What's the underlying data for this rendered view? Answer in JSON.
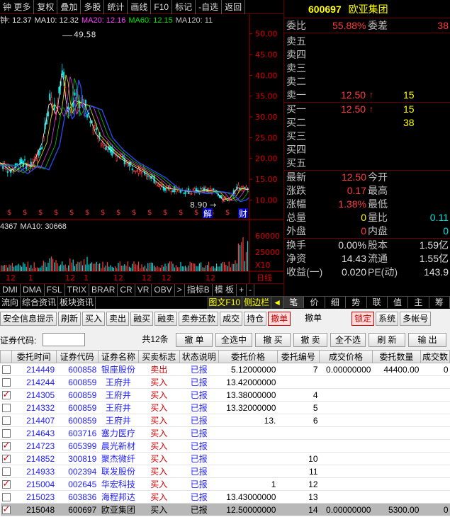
{
  "topbar": {
    "items": [
      "钟 更多",
      "复权",
      "叠加",
      "多股",
      "统计",
      "画线",
      "F10",
      "标记",
      "-自选",
      "返回"
    ]
  },
  "ma": {
    "items": [
      {
        "text": "钟: 12.37",
        "color": "#e0e0e0"
      },
      {
        "text": "MA10: 12.32",
        "color": "#e0e0e0"
      },
      {
        "text": "MA20: 12.16",
        "color": "#ff40ff"
      },
      {
        "text": "MA60: 12.15",
        "color": "#00e000"
      },
      {
        "text": "MA120: 11",
        "color": "#c0c0c0"
      }
    ]
  },
  "volume_line": {
    "items": [
      {
        "text": "4367",
        "color": "#e0e0e0"
      },
      {
        "text": "MA10: 30668",
        "color": "#e0e0e0"
      }
    ]
  },
  "chart_labels": {
    "high": "49.58",
    "low": "8.90",
    "price_axis": [
      "50.00",
      "45.00",
      "40.00",
      "35.00",
      "30.00",
      "25.00",
      "20.00",
      "15.00",
      "10.00"
    ],
    "vol_axis": [
      "60000",
      "25000",
      "X10"
    ],
    "time_axis": [
      "12",
      "1",
      "12",
      "1",
      "12",
      "12",
      "12",
      "12",
      "日线"
    ],
    "markers": [
      "解",
      "财"
    ]
  },
  "indicator_tabs": [
    "DMI",
    "DMA",
    "FSL",
    "TRIX",
    "BRAR",
    "CR",
    "VR",
    "OBV",
    ">",
    "指标B",
    "模 板",
    "+",
    "-"
  ],
  "bottom_tabs": [
    "流向",
    "综合资讯",
    "板块资讯",
    "图文F10",
    "侧边栏",
    "◄",
    "笔",
    "价",
    "细",
    "势",
    "联",
    "值",
    "主",
    "筹"
  ],
  "quote": {
    "code": "600697",
    "name": "欧亚集团",
    "weibi_label": "委比",
    "weibi_value": "55.88%",
    "weicha_label": "委差",
    "weicha_value": "38",
    "sell": [
      {
        "label": "卖五",
        "price": "",
        "vol": ""
      },
      {
        "label": "卖四",
        "price": "",
        "vol": ""
      },
      {
        "label": "卖三",
        "price": "",
        "vol": ""
      },
      {
        "label": "卖二",
        "price": "",
        "vol": ""
      },
      {
        "label": "卖一",
        "price": "12.50",
        "arrow": "↑",
        "vol": "15"
      }
    ],
    "buy": [
      {
        "label": "买一",
        "price": "12.50",
        "arrow": "↑",
        "vol": "15"
      },
      {
        "label": "买二",
        "price": "",
        "vol": "38"
      },
      {
        "label": "买三",
        "price": "",
        "vol": ""
      },
      {
        "label": "买四",
        "price": "",
        "vol": ""
      },
      {
        "label": "买五",
        "price": "",
        "vol": ""
      }
    ],
    "stats1": [
      {
        "l1": "最新",
        "v1": "12.50",
        "c1": "red",
        "l2": "今开",
        "v2": "",
        "c2": "wht"
      },
      {
        "l1": "涨跌",
        "v1": "0.17",
        "c1": "red",
        "l2": "最高",
        "v2": "",
        "c2": "wht"
      },
      {
        "l1": "涨幅",
        "v1": "1.38%",
        "c1": "red",
        "l2": "最低",
        "v2": "",
        "c2": "wht"
      },
      {
        "l1": "总量",
        "v1": "0",
        "c1": "yel",
        "l2": "量比",
        "v2": "0.11",
        "c2": "cyn"
      },
      {
        "l1": "外盘",
        "v1": "0",
        "c1": "red",
        "l2": "内盘",
        "v2": "0",
        "c2": "cyn"
      }
    ],
    "stats2": [
      {
        "l1": "换手",
        "v1": "0.00%",
        "c1": "wht",
        "l2": "股本",
        "v2": "1.59亿",
        "c2": "wht"
      },
      {
        "l1": "净资",
        "v1": "14.43",
        "c1": "wht",
        "l2": "流通",
        "v2": "1.55亿",
        "c2": "wht"
      },
      {
        "l1": "收益(一)",
        "v1": "0.020",
        "c1": "wht",
        "l2": "PE(动)",
        "v2": "143.9",
        "c2": "wht"
      }
    ]
  },
  "toolbar": {
    "buttons": [
      "安全信息提示",
      "刷新",
      "买入",
      "卖出",
      "融买",
      "融卖",
      "卖券还款",
      "成交",
      "持仓",
      "撤单",
      "撤单",
      "锁定",
      "系统",
      "多帐号"
    ]
  },
  "filter": {
    "label": "证券代码:",
    "input_value": "",
    "count": "共12条",
    "buttons": [
      "撤 单",
      "全选中",
      "撤 买",
      "撤 卖",
      "全不选",
      "刷 新",
      "输 出"
    ]
  },
  "orders": {
    "columns": [
      "委托时间",
      "证券代码",
      "证券名称",
      "买卖标志",
      "状态说明",
      "委托价格",
      "委托编号",
      "成交价格",
      "委托数量",
      "成交数"
    ],
    "rows": [
      {
        "checked": false,
        "time": "214449",
        "code": "600858",
        "name": "银座股份",
        "side": "卖出",
        "status": "已报",
        "price": "5.12000000",
        "no": "7",
        "deal": "0.00000000",
        "qty": "44400.00",
        "dq": "0",
        "sel": false
      },
      {
        "checked": false,
        "time": "214244",
        "code": "600859",
        "name": "王府井",
        "side": "买入",
        "status": "已报",
        "price": "13.42000000",
        "no": "",
        "deal": "",
        "qty": "",
        "dq": "",
        "sel": false
      },
      {
        "checked": true,
        "time": "214305",
        "code": "600859",
        "name": "王府井",
        "side": "买入",
        "status": "已报",
        "price": "13.38000000",
        "no": "4",
        "deal": "",
        "qty": "",
        "dq": "",
        "sel": false
      },
      {
        "checked": false,
        "time": "214332",
        "code": "600859",
        "name": "王府井",
        "side": "买入",
        "status": "已报",
        "price": "13.32000000",
        "no": "5",
        "deal": "",
        "qty": "",
        "dq": "",
        "sel": false
      },
      {
        "checked": false,
        "time": "214407",
        "code": "600859",
        "name": "王府井",
        "side": "买入",
        "status": "已报",
        "price": "13.",
        "no": "6",
        "deal": "",
        "qty": "",
        "dq": "",
        "sel": false
      },
      {
        "checked": false,
        "time": "214643",
        "code": "603716",
        "name": "塞力医疗",
        "side": "买入",
        "status": "已报",
        "price": "",
        "no": "",
        "deal": "",
        "qty": "",
        "dq": "",
        "sel": false
      },
      {
        "checked": true,
        "time": "214723",
        "code": "605399",
        "name": "晨光新材",
        "side": "买入",
        "status": "已报",
        "price": "",
        "no": "",
        "deal": "",
        "qty": "",
        "dq": "",
        "sel": false
      },
      {
        "checked": true,
        "time": "214852",
        "code": "300819",
        "name": "聚杰微纤",
        "side": "买入",
        "status": "已报",
        "price": "",
        "no": "10",
        "deal": "",
        "qty": "",
        "dq": "",
        "sel": false
      },
      {
        "checked": false,
        "time": "214933",
        "code": "002394",
        "name": "联发股份",
        "side": "买入",
        "status": "已报",
        "price": "",
        "no": "11",
        "deal": "",
        "qty": "",
        "dq": "",
        "sel": false
      },
      {
        "checked": true,
        "time": "215004",
        "code": "002645",
        "name": "华宏科技",
        "side": "买入",
        "status": "已报",
        "price": "1",
        "no": "12",
        "deal": "",
        "qty": "",
        "dq": "",
        "sel": false
      },
      {
        "checked": false,
        "time": "215023",
        "code": "603836",
        "name": "海程邦达",
        "side": "买入",
        "status": "已报",
        "price": "13.43000000",
        "no": "13",
        "deal": "",
        "qty": "",
        "dq": "",
        "sel": false
      },
      {
        "checked": true,
        "time": "215048",
        "code": "600697",
        "name": "欧亚集团",
        "side": "买入",
        "status": "已报",
        "price": "12.50000000",
        "no": "14",
        "deal": "0.00000000",
        "qty": "5300.00",
        "dq": "0",
        "sel": true
      }
    ]
  }
}
